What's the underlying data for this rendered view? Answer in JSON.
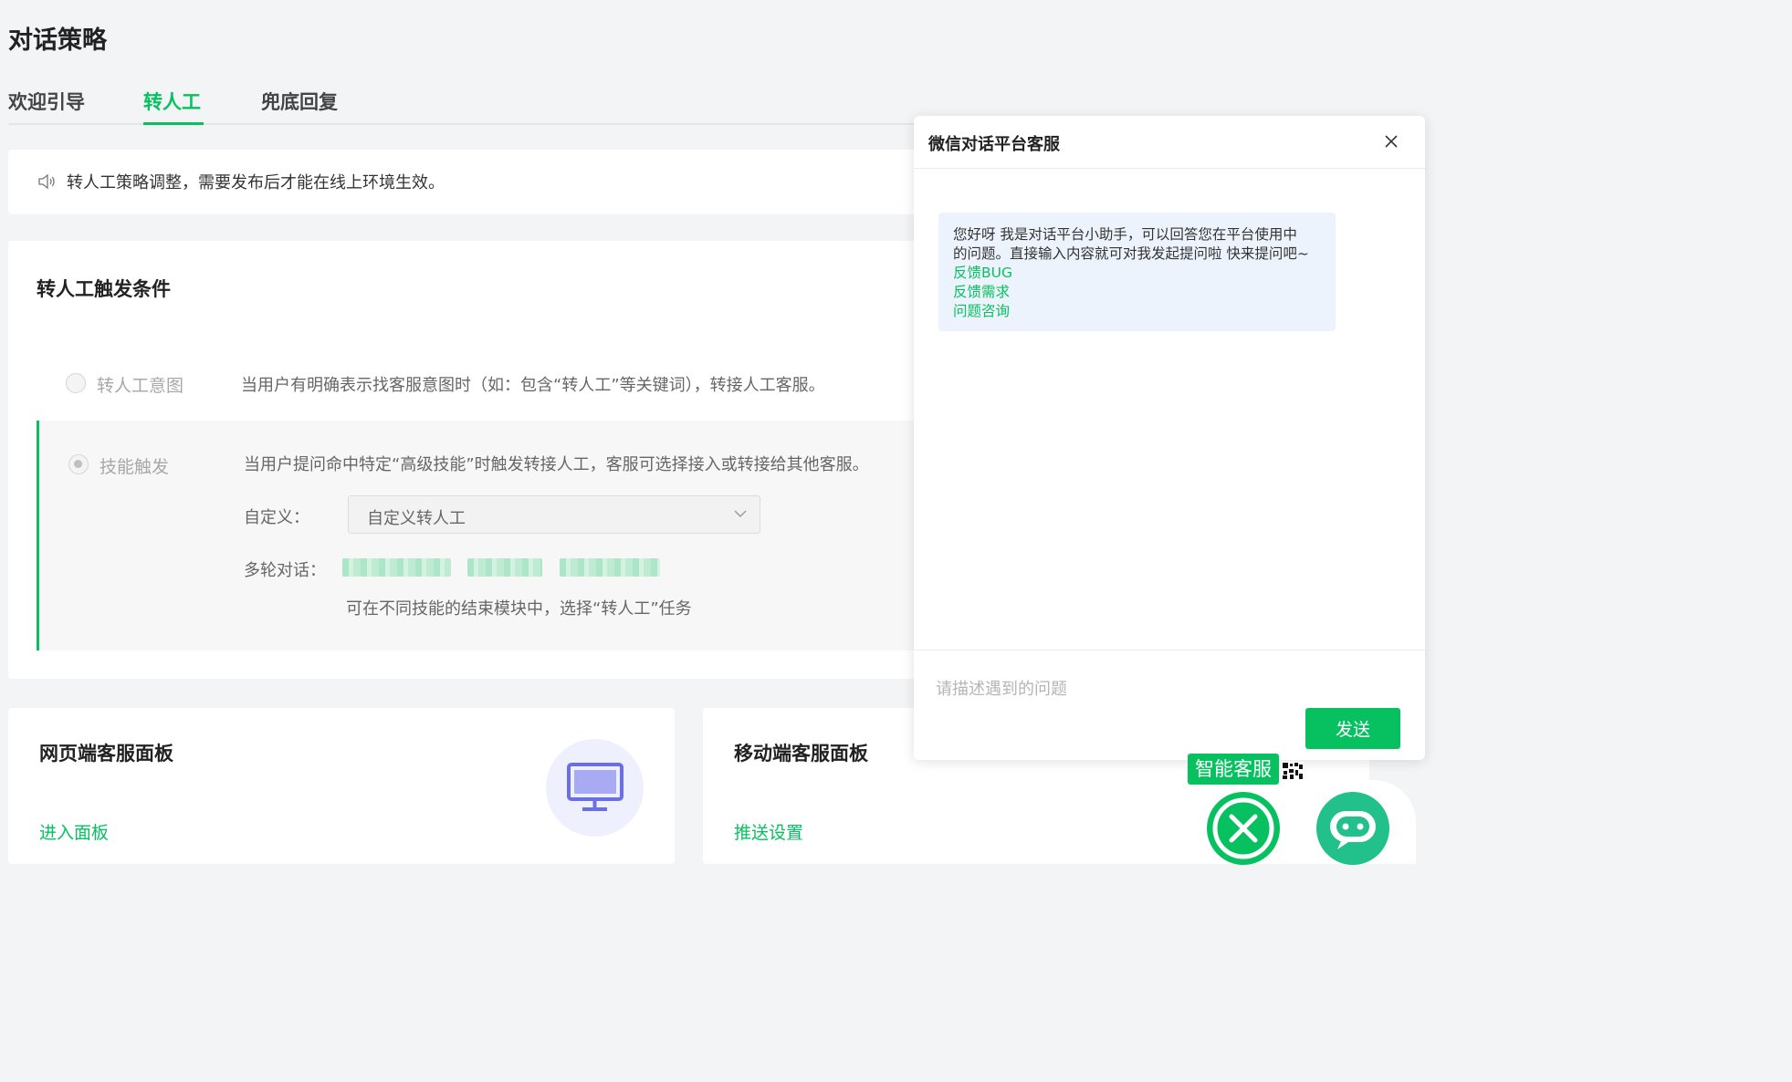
{
  "page": {
    "title": "对话策略",
    "tabs": [
      {
        "label": "欢迎引导",
        "active": false
      },
      {
        "label": "转人工",
        "active": true
      },
      {
        "label": "兜底回复",
        "active": false
      }
    ],
    "notice": "转人工策略调整，需要发布后才能在线上环境生效。"
  },
  "trigger": {
    "title": "转人工触发条件",
    "options": [
      {
        "label": "转人工意图",
        "desc": "当用户有明确表示找客服意图时（如：包含“转人工”等关键词），转接人工客服。",
        "checked": false
      },
      {
        "label": "技能触发",
        "desc": "当用户提问命中特定“高级技能”时触发转接人工，客服可选择接入或转接给其他客服。",
        "checked": true
      }
    ],
    "custom_label": "自定义：",
    "custom_value": "自定义转人工",
    "multi_turn_label": "多轮对话：",
    "hint": "可在不同技能的结束模块中，选择“转人工”任务"
  },
  "panels": {
    "web": {
      "title": "网页端客服面板",
      "link": "进入面板"
    },
    "mobile": {
      "title": "移动端客服面板",
      "link": "推送设置"
    }
  },
  "chat": {
    "title": "微信对话平台客服",
    "greeting_line1": "您好呀 我是对话平台小助手，可以回答您在平台使用中",
    "greeting_line2": "的问题。直接输入内容就可对我发起提问啦 快来提问吧~",
    "links": [
      "反馈BUG",
      "反馈需求",
      "问题咨询"
    ],
    "input_placeholder": "请描述遇到的问题",
    "send_label": "发送"
  },
  "assistant": {
    "tag": "智能客服"
  },
  "colors": {
    "accent": "#07c160",
    "bubble": "#edf3fc",
    "monitor": "#6b6fe6"
  }
}
